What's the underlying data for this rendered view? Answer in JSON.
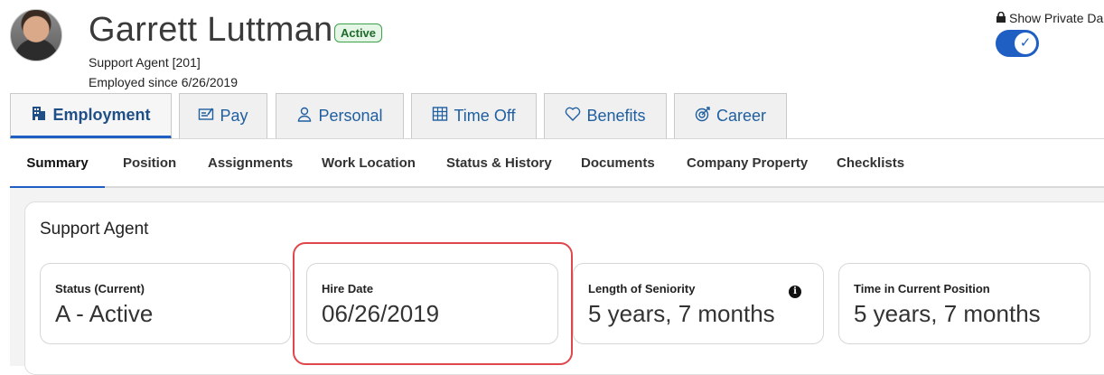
{
  "header": {
    "name": "Garrett Luttman",
    "status_badge": "Active",
    "role_line": "Support Agent [201]",
    "employed_line": "Employed since 6/26/2019",
    "private_toggle_label": "Show Private Da",
    "private_toggle_on": true
  },
  "tabs": [
    {
      "label": "Employment",
      "icon": "building-icon",
      "active": true
    },
    {
      "label": "Pay",
      "icon": "paycheck-icon",
      "active": false
    },
    {
      "label": "Personal",
      "icon": "person-icon",
      "active": false
    },
    {
      "label": "Time Off",
      "icon": "calendar-grid-icon",
      "active": false
    },
    {
      "label": "Benefits",
      "icon": "heart-icon",
      "active": false
    },
    {
      "label": "Career",
      "icon": "target-icon",
      "active": false
    }
  ],
  "subtabs": [
    {
      "label": "Summary",
      "active": true
    },
    {
      "label": "Position"
    },
    {
      "label": "Assignments"
    },
    {
      "label": "Work Location"
    },
    {
      "label": "Status & History"
    },
    {
      "label": "Documents"
    },
    {
      "label": "Company Property"
    },
    {
      "label": "Checklists"
    }
  ],
  "summary": {
    "title": "Support Agent",
    "cards": [
      {
        "label": "Status (Current)",
        "value": "A - Active"
      },
      {
        "label": "Hire Date",
        "value": "06/26/2019"
      },
      {
        "label": "Length of Seniority",
        "value": "5 years, 7 months"
      },
      {
        "label": "Time in Current Position",
        "value": "5 years, 7 months"
      }
    ]
  },
  "colors": {
    "accent": "#1f5fc4",
    "highlight": "#e0474c",
    "badge_green": "#3ca24b"
  }
}
